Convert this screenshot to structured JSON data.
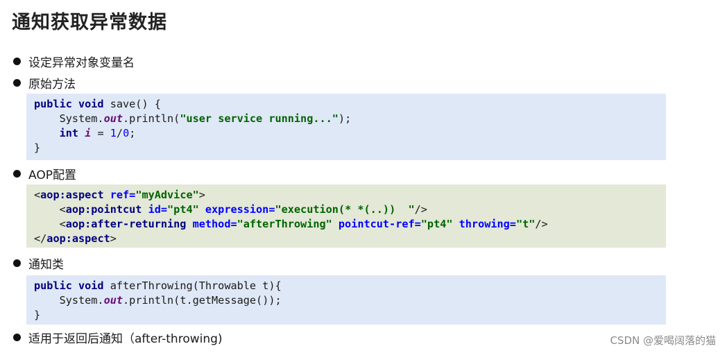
{
  "title": "通知获取异常数据",
  "bullets": {
    "b1": "设定异常对象变量名",
    "b2": "原始方法",
    "b3": "AOP配置",
    "b4": "通知类",
    "b5": "适用于返回后通知（after-throwing)"
  },
  "code1": {
    "l1_kw": "public void",
    "l1_rest": " save() {",
    "l2_a": "    System.",
    "l2_fld": "out",
    "l2_b": ".println(",
    "l2_str": "\"user service running...\"",
    "l2_c": ");",
    "l3_kw": "    int",
    "l3_sp": " ",
    "l3_var": "i",
    "l3_eq": " = ",
    "l3_n1": "1",
    "l3_slash": "/",
    "l3_n2": "0",
    "l3_semi": ";",
    "l4": "}"
  },
  "code2": {
    "l1_lt": "<",
    "l1_tag": "aop:aspect",
    "l1_attr": " ref=",
    "l1_val": "\"myAdvice\"",
    "l1_gt": ">",
    "l2_lt": "    <",
    "l2_tag": "aop:pointcut",
    "l2_attr1": " id=",
    "l2_val1": "\"pt4\"",
    "l2_attr2": " expression=",
    "l2_val2": "\"execution(* *(..))  \"",
    "l2_end": "/>",
    "l3_lt": "    <",
    "l3_tag": "aop:after-returning",
    "l3_attr1": " method=",
    "l3_val1": "\"afterThrowing\"",
    "l3_attr2": " pointcut-ref=",
    "l3_val2": "\"pt4\"",
    "l3_attr3": " throwing=",
    "l3_val3": "\"t\"",
    "l3_end": "/>",
    "l4_lt": "</",
    "l4_tag": "aop:aspect",
    "l4_gt": ">"
  },
  "code3": {
    "l1_kw": "public void",
    "l1_rest": " afterThrowing(Throwable t){",
    "l2_a": "    System.",
    "l2_fld": "out",
    "l2_b": ".println(t.getMessage());",
    "l3": "}"
  },
  "watermark": "CSDN @爱喝阔落的猫"
}
